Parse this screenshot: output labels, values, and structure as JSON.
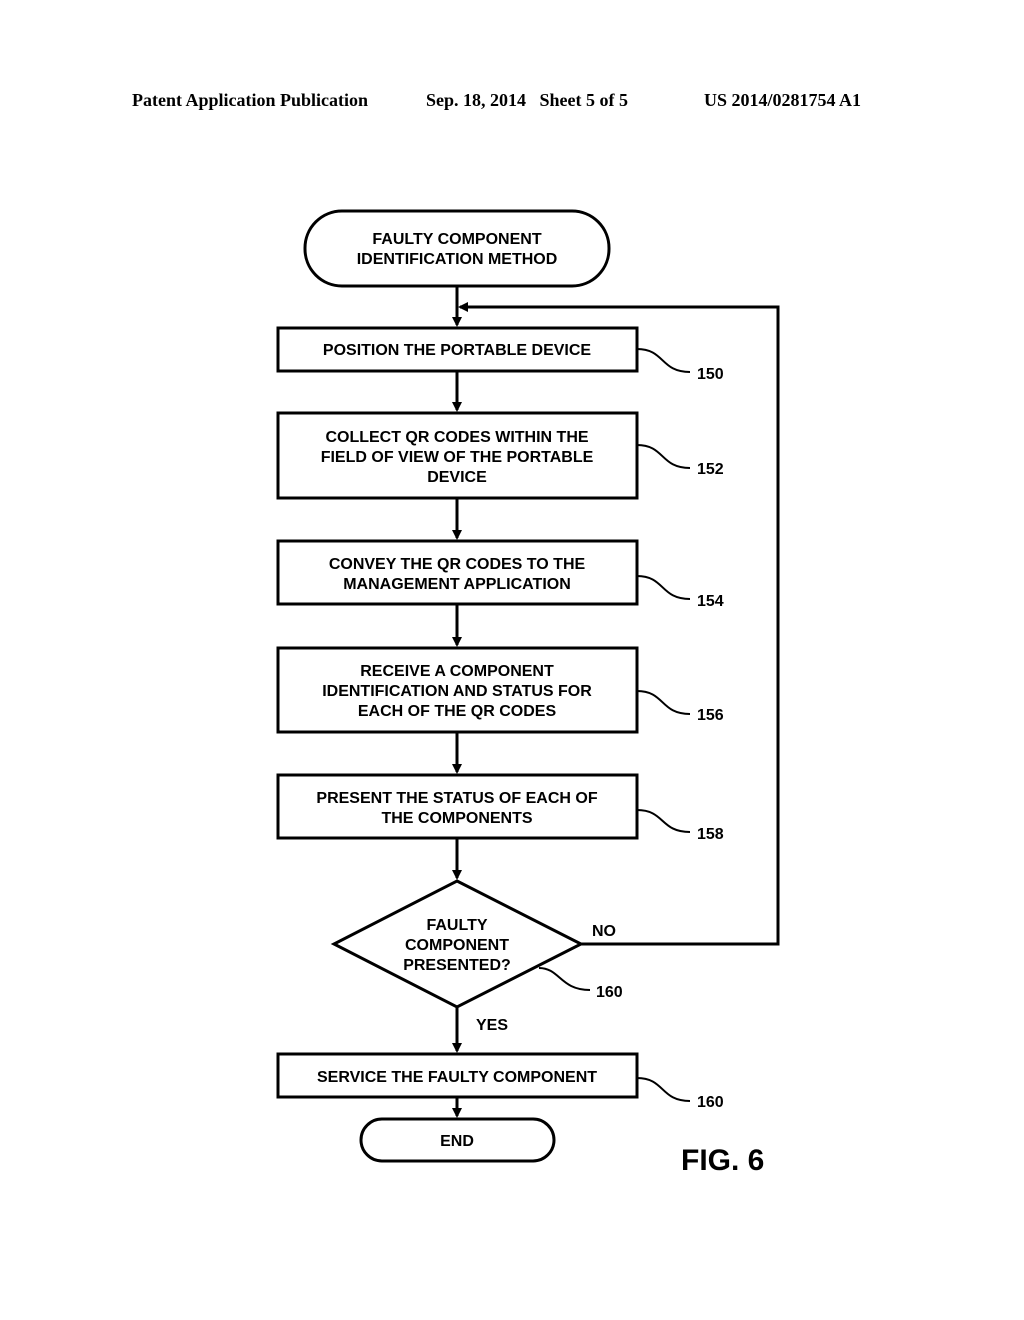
{
  "header": {
    "publication": "Patent Application Publication",
    "date_sheet": "Sep. 18, 2014   Sheet 5 of 5",
    "number": "US 2014/0281754 A1"
  },
  "diagram": {
    "figure_label": "FIG. 6",
    "start": {
      "lines": [
        "FAULTY COMPONENT",
        "IDENTIFICATION METHOD"
      ]
    },
    "steps": [
      {
        "ref": "150",
        "lines": [
          "POSITION THE PORTABLE DEVICE"
        ]
      },
      {
        "ref": "152",
        "lines": [
          "COLLECT QR CODES WITHIN THE",
          "FIELD OF VIEW OF THE PORTABLE",
          "DEVICE"
        ]
      },
      {
        "ref": "154",
        "lines": [
          "CONVEY THE QR CODES TO THE",
          "MANAGEMENT APPLICATION"
        ]
      },
      {
        "ref": "156",
        "lines": [
          "RECEIVE A COMPONENT",
          "IDENTIFICATION AND STATUS FOR",
          "EACH OF THE QR CODES"
        ]
      },
      {
        "ref": "158",
        "lines": [
          "PRESENT THE STATUS OF EACH OF",
          "THE COMPONENTS"
        ]
      }
    ],
    "decision": {
      "ref": "160",
      "lines": [
        "FAULTY",
        "COMPONENT",
        "PRESENTED?"
      ],
      "no_label": "NO",
      "yes_label": "YES"
    },
    "final_step": {
      "ref": "160",
      "lines": [
        "SERVICE THE FAULTY COMPONENT"
      ]
    },
    "end": {
      "lines": [
        "END"
      ]
    }
  }
}
